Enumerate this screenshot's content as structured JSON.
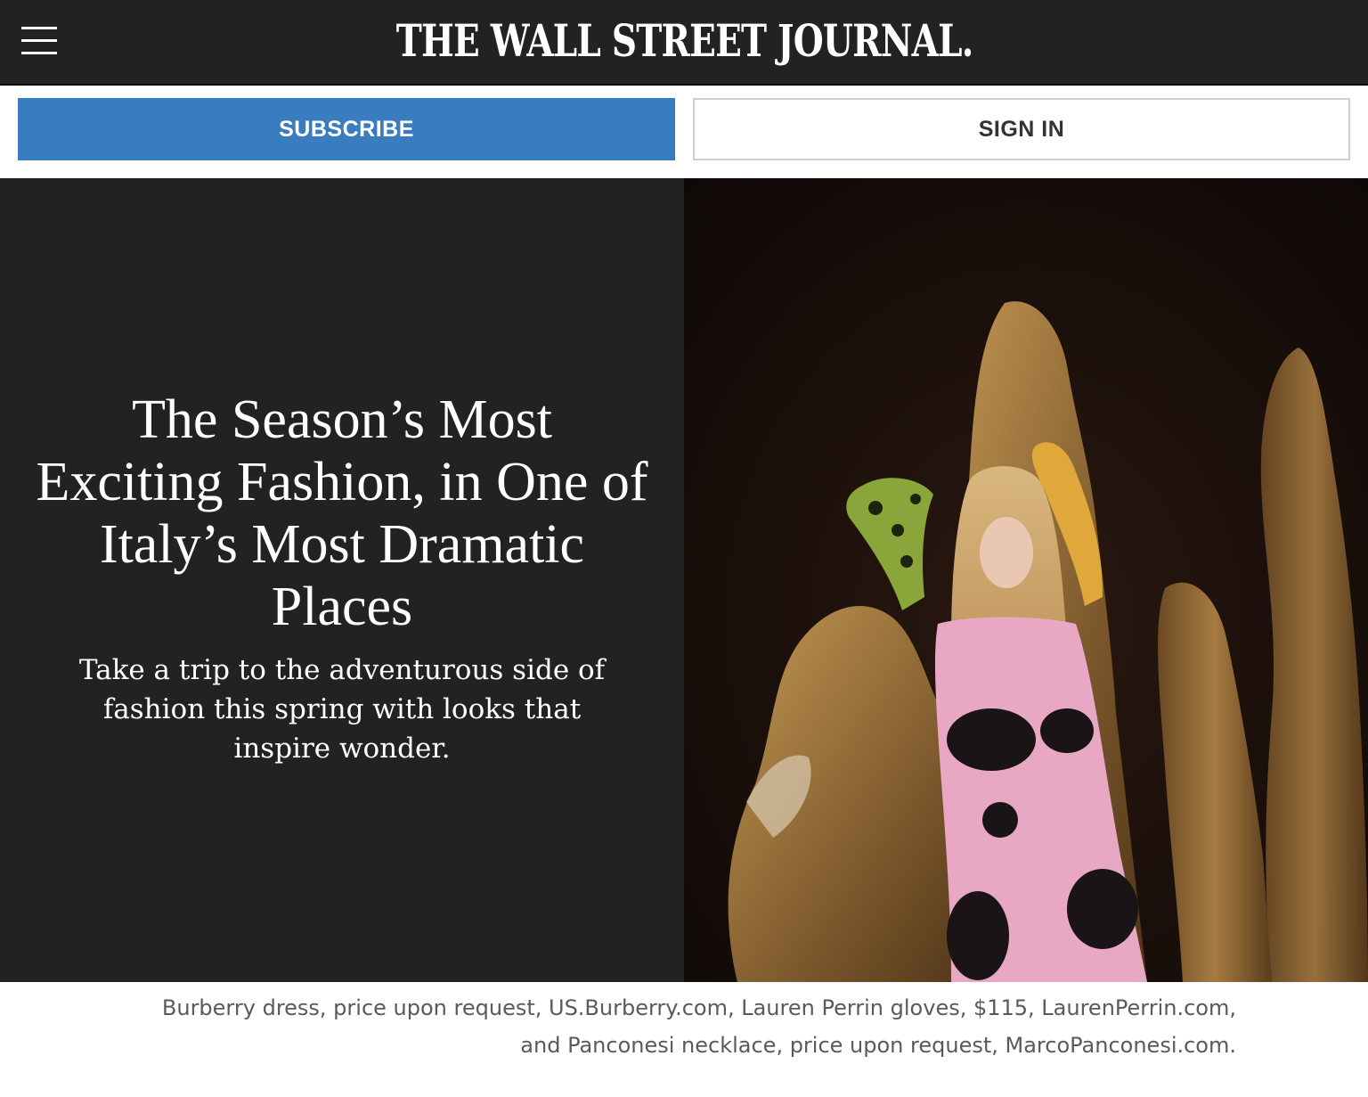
{
  "header": {
    "masthead": "THE WALL STREET JOURNAL.",
    "menu_icon": "hamburger-menu-icon",
    "background_color": "#222222"
  },
  "actions": {
    "subscribe_label": "SUBSCRIBE",
    "signin_label": "SIGN IN",
    "subscribe_color": "#3a7cc0"
  },
  "article": {
    "headline": "The Season’s Most Exciting Fashion, in One of Italy’s Most Dramatic Places",
    "dek": "Take a trip to the adventurous side of fashion this spring with looks that inspire wonder.",
    "image_alt": "Model in pink dress with black spots posing among cave stalagmites",
    "caption": "Burberry dress, price upon request, US.Burberry.com, Lauren Perrin gloves, $115, LaurenPerrin.com, and Panconesi necklace, price upon request, MarcoPanconesi.com."
  }
}
